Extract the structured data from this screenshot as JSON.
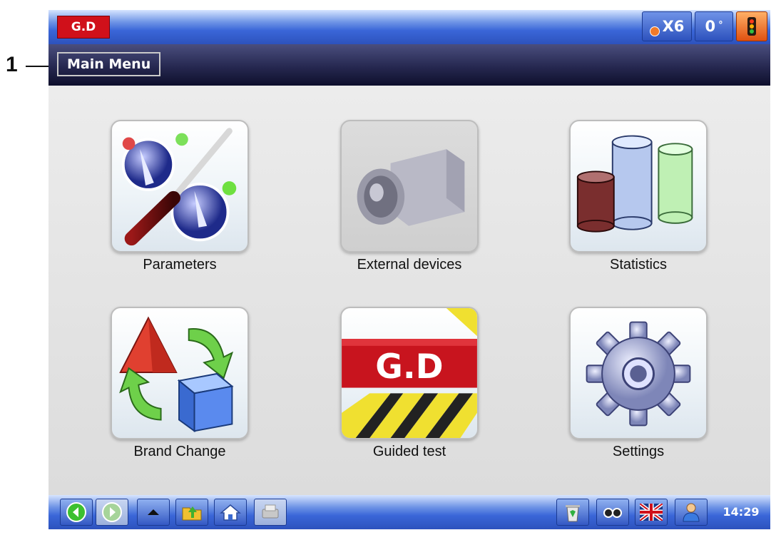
{
  "callout": {
    "number": "1"
  },
  "header": {
    "logo": "G.D",
    "multiplier": "X6",
    "counter": "0",
    "counter_unit": "°",
    "status_light": "traffic-light-icon"
  },
  "title": "Main Menu",
  "menu": [
    {
      "label": "Parameters",
      "icon": "screwdriver-icon",
      "enabled": true
    },
    {
      "label": "External devices",
      "icon": "camera-icon",
      "enabled": false
    },
    {
      "label": "Statistics",
      "icon": "cylinder-chart-icon",
      "enabled": true
    },
    {
      "label": "Brand Change",
      "icon": "shapes-arrows-icon",
      "enabled": true
    },
    {
      "label": "Guided test",
      "icon": "gd-logo-icon",
      "logo_text": "G.D",
      "enabled": true
    },
    {
      "label": "Settings",
      "icon": "gear-icon",
      "enabled": true
    }
  ],
  "footer": {
    "buttons": [
      "back-icon",
      "forward-icon",
      "up-icon",
      "folder-icon",
      "home-icon",
      "print-icon"
    ],
    "right_buttons": [
      "recycle-icon",
      "glasses-icon",
      "uk-flag-icon",
      "user-icon"
    ],
    "time": "14:29"
  },
  "colors": {
    "brand_red": "#d0101a",
    "bar_blue": "#3a66d8",
    "title_bar": "#1c1e44"
  }
}
